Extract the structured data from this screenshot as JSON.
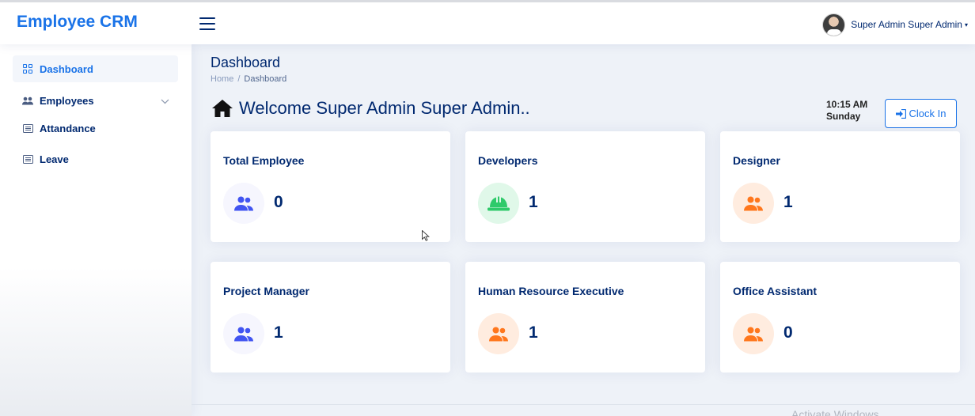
{
  "app": {
    "title": "Employee CRM"
  },
  "header": {
    "user_name": "Super Admin Super Admin",
    "caret": "▾"
  },
  "sidebar": {
    "items": [
      {
        "label": "Dashboard",
        "icon": "grid-icon",
        "active": true
      },
      {
        "label": "Employees",
        "icon": "people-icon",
        "expandable": true
      },
      {
        "label": "Attandance",
        "icon": "list-icon"
      },
      {
        "label": "Leave",
        "icon": "list-icon"
      }
    ]
  },
  "page": {
    "title": "Dashboard",
    "breadcrumb": {
      "home": "Home",
      "separator": "/",
      "current": "Dashboard"
    },
    "welcome": "Welcome Super Admin Super Admin..",
    "time": "10:15 AM",
    "day": "Sunday",
    "clock_in_label": "Clock In"
  },
  "cards": [
    {
      "title": "Total Employee",
      "value": "0",
      "icon": "people-icon",
      "color": "#4154f1",
      "bg": "#f6f6fe"
    },
    {
      "title": "Developers",
      "value": "1",
      "icon": "hardhat-icon",
      "color": "#2eca6a",
      "bg": "#e0f8e9"
    },
    {
      "title": "Designer",
      "value": "1",
      "icon": "people-icon",
      "color": "#ff771d",
      "bg": "#ffecdf"
    },
    {
      "title": "Project Manager",
      "value": "1",
      "icon": "people-icon",
      "color": "#4154f1",
      "bg": "#f6f6fe"
    },
    {
      "title": "Human Resource Executive",
      "value": "1",
      "icon": "people-icon",
      "color": "#ff771d",
      "bg": "#ffecdf"
    },
    {
      "title": "Office Assistant",
      "value": "0",
      "icon": "people-icon",
      "color": "#ff771d",
      "bg": "#ffecdf"
    }
  ],
  "watermark": "Activate Windows",
  "colors": {
    "brand": "#1a73e8",
    "text": "#012970"
  }
}
